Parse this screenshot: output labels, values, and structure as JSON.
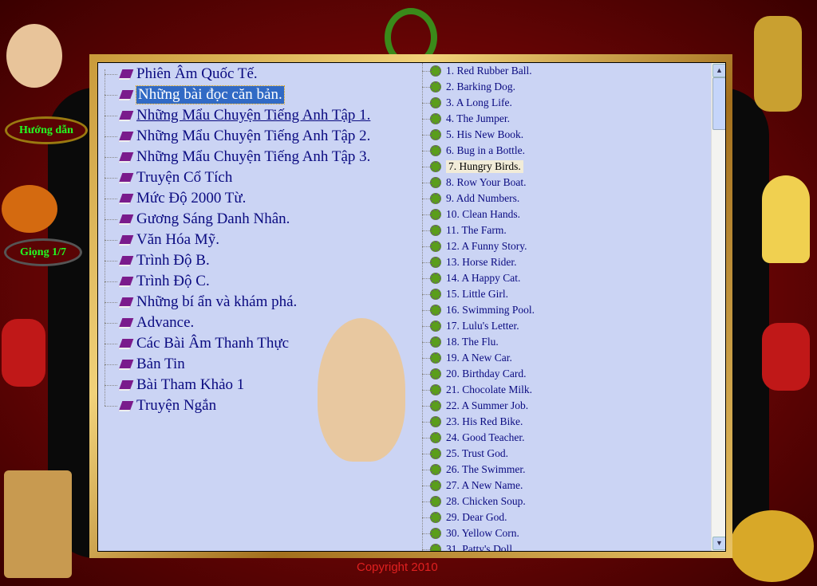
{
  "sidebar": {
    "guide_label": "Hướng dẫn",
    "voice_label": "Giọng 1/7"
  },
  "categories": [
    {
      "label": "Phiên Âm Quốc Tế."
    },
    {
      "label": "Những bài đọc căn bản.",
      "selected": true
    },
    {
      "label": "Những Mẩu Chuyện Tiếng Anh Tập 1.",
      "hovered": true
    },
    {
      "label": "Những Mẩu Chuyện Tiếng Anh Tập 2."
    },
    {
      "label": "Những Mẩu Chuyện Tiếng Anh Tập 3."
    },
    {
      "label": "Truyện Cổ Tích"
    },
    {
      "label": "Mức Độ 2000 Từ."
    },
    {
      "label": "Gương Sáng Danh Nhân."
    },
    {
      "label": "Văn Hóa Mỹ."
    },
    {
      "label": "Trình Độ B."
    },
    {
      "label": "Trình Độ C."
    },
    {
      "label": "Những bí ẩn và khám phá."
    },
    {
      "label": "Advance."
    },
    {
      "label": "Các Bài Âm Thanh Thực"
    },
    {
      "label": "Bản Tin"
    },
    {
      "label": "Bài Tham Khảo 1"
    },
    {
      "label": "Truyện Ngắn"
    }
  ],
  "lessons": [
    "1. Red Rubber Ball.",
    "2. Barking Dog.",
    "3. A Long Life.",
    "4. The Jumper.",
    "5. His New Book.",
    "6. Bug in a Bottle.",
    "7. Hungry Birds.",
    "8. Row Your Boat.",
    "9. Add Numbers.",
    "10. Clean Hands.",
    "11. The Farm.",
    "12. A Funny Story.",
    "13. Horse Rider.",
    "14. A Happy Cat.",
    "15. Little Girl.",
    "16. Swimming Pool.",
    "17. Lulu's Letter.",
    "18. The Flu.",
    "19. A New Car.",
    "20. Birthday Card.",
    "21. Chocolate Milk.",
    "22. A Summer Job.",
    "23. His Red Bike.",
    "24. Good Teacher.",
    "25. Trust God.",
    "26. The Swimmer.",
    "27. A New Name.",
    "28. Chicken Soup.",
    "29. Dear God.",
    "30. Yellow Corn.",
    "31. Patty's Doll."
  ],
  "highlighted_lesson": "7. Hungry Birds.",
  "footer": {
    "copyright": "Copyright 2010"
  }
}
